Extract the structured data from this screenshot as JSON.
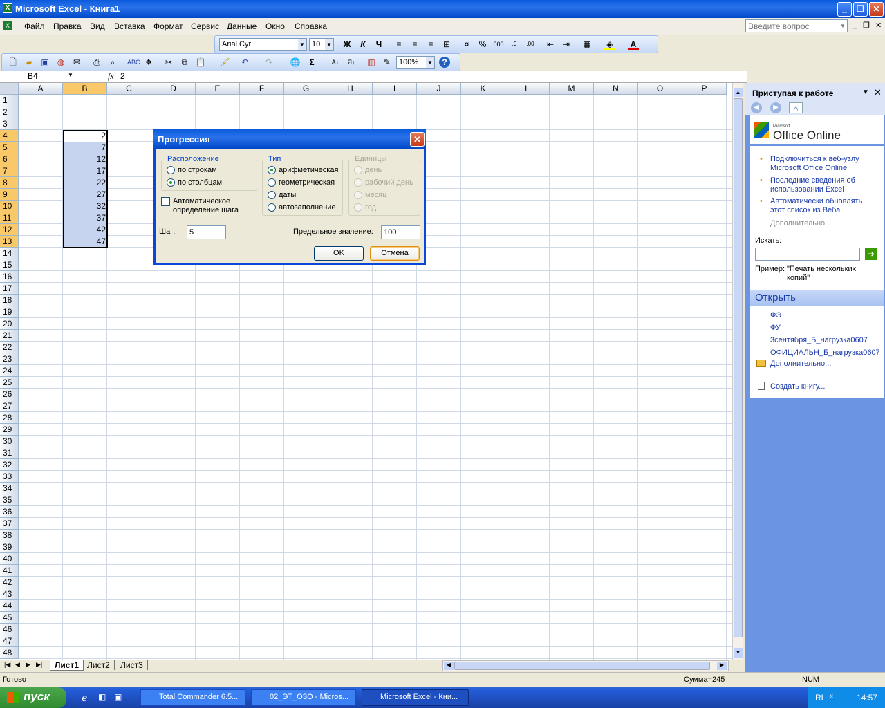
{
  "app": {
    "title": "Microsoft Excel - Книга1"
  },
  "menu": [
    "Файл",
    "Правка",
    "Вид",
    "Вставка",
    "Формат",
    "Сервис",
    "Данные",
    "Окно",
    "Справка"
  ],
  "help_placeholder": "Введите вопрос",
  "format_toolbar": {
    "font": "Arial Cyr",
    "size": "10"
  },
  "std_toolbar": {
    "zoom": "100%"
  },
  "formula_bar": {
    "name_box": "B4",
    "fx": "fx",
    "value": "2"
  },
  "columns": [
    "A",
    "B",
    "C",
    "D",
    "E",
    "F",
    "G",
    "H",
    "I",
    "J",
    "K",
    "L",
    "M",
    "N",
    "O",
    "P"
  ],
  "rows": [
    "1",
    "2",
    "3",
    "4",
    "5",
    "6",
    "7",
    "8",
    "9",
    "10",
    "11",
    "12",
    "13",
    "14",
    "15",
    "16",
    "17",
    "18",
    "19",
    "20",
    "21",
    "22",
    "23",
    "24",
    "25",
    "26",
    "27",
    "28",
    "29",
    "30",
    "31",
    "32",
    "33",
    "34",
    "35",
    "36",
    "37",
    "38",
    "39",
    "40",
    "41",
    "42",
    "43",
    "44",
    "45",
    "46",
    "47",
    "48"
  ],
  "cells": [
    "2",
    "7",
    "12",
    "17",
    "22",
    "27",
    "32",
    "37",
    "42",
    "47"
  ],
  "sheets": [
    "Лист1",
    "Лист2",
    "Лист3"
  ],
  "status": {
    "ready": "Готово",
    "sum": "Сумма=245",
    "num": "NUM"
  },
  "dialog": {
    "title": "Прогрессия",
    "placement": {
      "legend": "Расположение",
      "rows": "по строкам",
      "cols": "по столбцам"
    },
    "auto_step": "Автоматическое определение шага",
    "type": {
      "legend": "Тип",
      "arith": "арифметическая",
      "geom": "геометрическая",
      "dates": "даты",
      "autofill": "автозаполнение"
    },
    "units": {
      "legend": "Единицы",
      "day": "день",
      "workday": "рабочий день",
      "month": "месяц",
      "year": "год"
    },
    "step_label": "Шаг:",
    "step_value": "5",
    "limit_label": "Предельное значение:",
    "limit_value": "100",
    "ok": "OK",
    "cancel": "Отмена"
  },
  "taskpane": {
    "title": "Приступая к работе",
    "logo_small": "Microsoft",
    "logo": "Office Online",
    "links": [
      "Подключиться к веб-узлу Microsoft Office Online",
      "Последние сведения об использовании Excel",
      "Автоматически обновлять этот список из Веба"
    ],
    "more": "Дополнительно...",
    "search_label": "Искать:",
    "example_label": "Пример:",
    "example_text": "\"Печать нескольких копий\"",
    "open_header": "Открыть",
    "files": [
      "ФЭ",
      "ФУ",
      "3сентября_Б_нагрузка0607",
      "ОФИЦИАЛЬН_Б_нагрузка0607"
    ],
    "open_more": "Дополнительно...",
    "create": "Создать книгу..."
  },
  "taskbar": {
    "start": "пуск",
    "items": [
      "Total Commander 6.5...",
      "02_ЭТ_ОЗО - Micros...",
      "Microsoft Excel - Кни..."
    ],
    "lang": "RL",
    "time": "14:57"
  }
}
